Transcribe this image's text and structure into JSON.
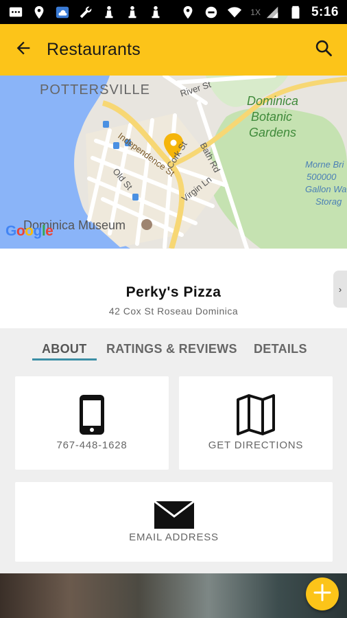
{
  "status_bar": {
    "time": "5:16",
    "speed_label": "1X",
    "icons": [
      "message-icon",
      "location-icon",
      "weather-icon",
      "wrench-icon",
      "chess-icon",
      "chess-icon",
      "chess-icon",
      "location-icon",
      "do-not-disturb-icon",
      "wifi-icon",
      "signal-icon",
      "battery-icon"
    ]
  },
  "app_bar": {
    "title": "Restaurants",
    "back_icon": "arrow-back-icon",
    "search_icon": "search-icon",
    "color": "#fcc419"
  },
  "map": {
    "labels": {
      "pottersville": "POTTERSVILLE",
      "river_st": "River St",
      "botanic_line1": "Dominica",
      "botanic_line2": "Botanic",
      "botanic_line3": "Gardens",
      "independence_st": "Independence St",
      "bath_rd": "Bath Rd",
      "old_st": "Old St",
      "cork_st": "Cork St",
      "virgin_ln": "Virgin Ln",
      "morne_line1": "Morne Bri",
      "morne_line2": "500000",
      "morne_line3": "Gallon Wa",
      "morne_line4": "Storag",
      "museum": "Dominica Museum"
    },
    "attribution": "Google"
  },
  "place": {
    "name": "Perky's Pizza",
    "address": "42 Cox St Roseau Dominica"
  },
  "tabs": [
    {
      "label": "ABOUT",
      "active": true
    },
    {
      "label": "RATINGS & REVIEWS",
      "active": false
    },
    {
      "label": "DETAILS",
      "active": false
    }
  ],
  "cards": {
    "phone": {
      "label": "767-448-1628",
      "icon": "phone-icon"
    },
    "directions": {
      "label": "GET DIRECTIONS",
      "icon": "map-icon"
    },
    "email": {
      "label": "EMAIL ADDRESS",
      "icon": "email-icon"
    }
  },
  "fab": {
    "icon": "plus-icon"
  },
  "colors": {
    "accent": "#fcc419",
    "tab_underline": "#3b8ea5"
  }
}
